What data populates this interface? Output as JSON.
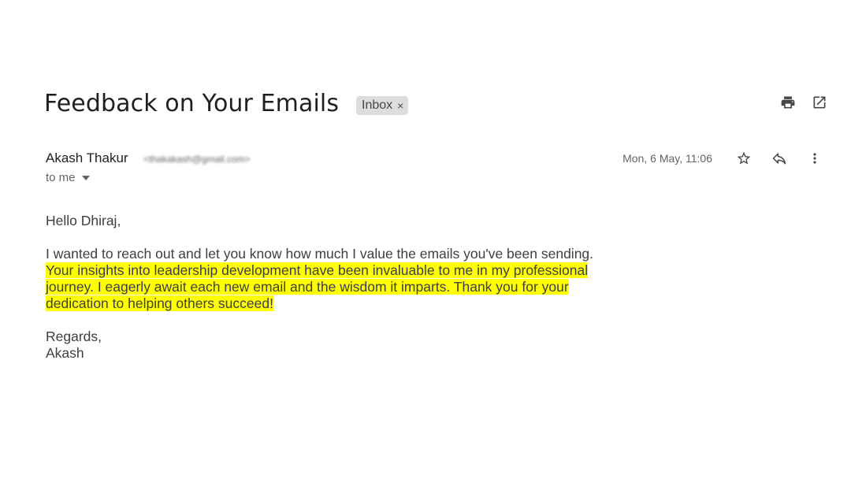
{
  "email": {
    "subject": "Feedback on Your Emails",
    "label": "Inbox",
    "label_remove": "×",
    "sender_name": "Akash Thakur",
    "sender_email": "<thakakash@gmail.com>",
    "recipient": "to me",
    "timestamp": "Mon, 6 May, 11:06",
    "greeting": "Hello Dhiraj,",
    "paragraph_first": "I wanted to reach out and let you know how much I value the emails you've been sending.",
    "paragraph_highlight": "Your insights into leadership development have been invaluable to me in my professional journey. I eagerly await each new email and the wisdom it imparts. Thank you for your dedication to helping others succeed!",
    "signoff": "Regards,",
    "signature": "Akash"
  },
  "icons": {
    "print": "print-icon",
    "open_new_window": "open-in-new-window-icon",
    "star": "star-icon",
    "reply": "reply-icon",
    "more": "more-vertical-icon"
  },
  "colors": {
    "highlight": "#ffff00",
    "chip_background": "#dddddd"
  }
}
